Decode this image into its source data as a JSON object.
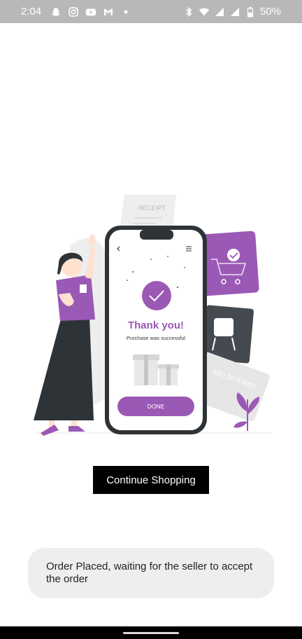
{
  "status_bar": {
    "time": "2:04",
    "battery": "50%",
    "icons": [
      "snapchat-icon",
      "instagram-icon",
      "youtube-icon",
      "gmail-icon",
      "dot-icon",
      "bluetooth-icon",
      "wifi-icon",
      "signal-icon",
      "battery-icon"
    ]
  },
  "illustration": {
    "receipt_text": "RECEIPT",
    "thank_you": "Thank you!",
    "purchase_text": "Purchase was successful",
    "done_label": "DONE",
    "card_number": "4321 5678 9000",
    "accent_color": "#9b59b6"
  },
  "main": {
    "continue_label": "Continue Shopping"
  },
  "toast": {
    "message": "Order Placed, waiting for the seller to accept the order"
  },
  "colors": {
    "status_bar": "#b8b8b8",
    "button": "#000000",
    "toast_bg": "#eeeeee"
  }
}
